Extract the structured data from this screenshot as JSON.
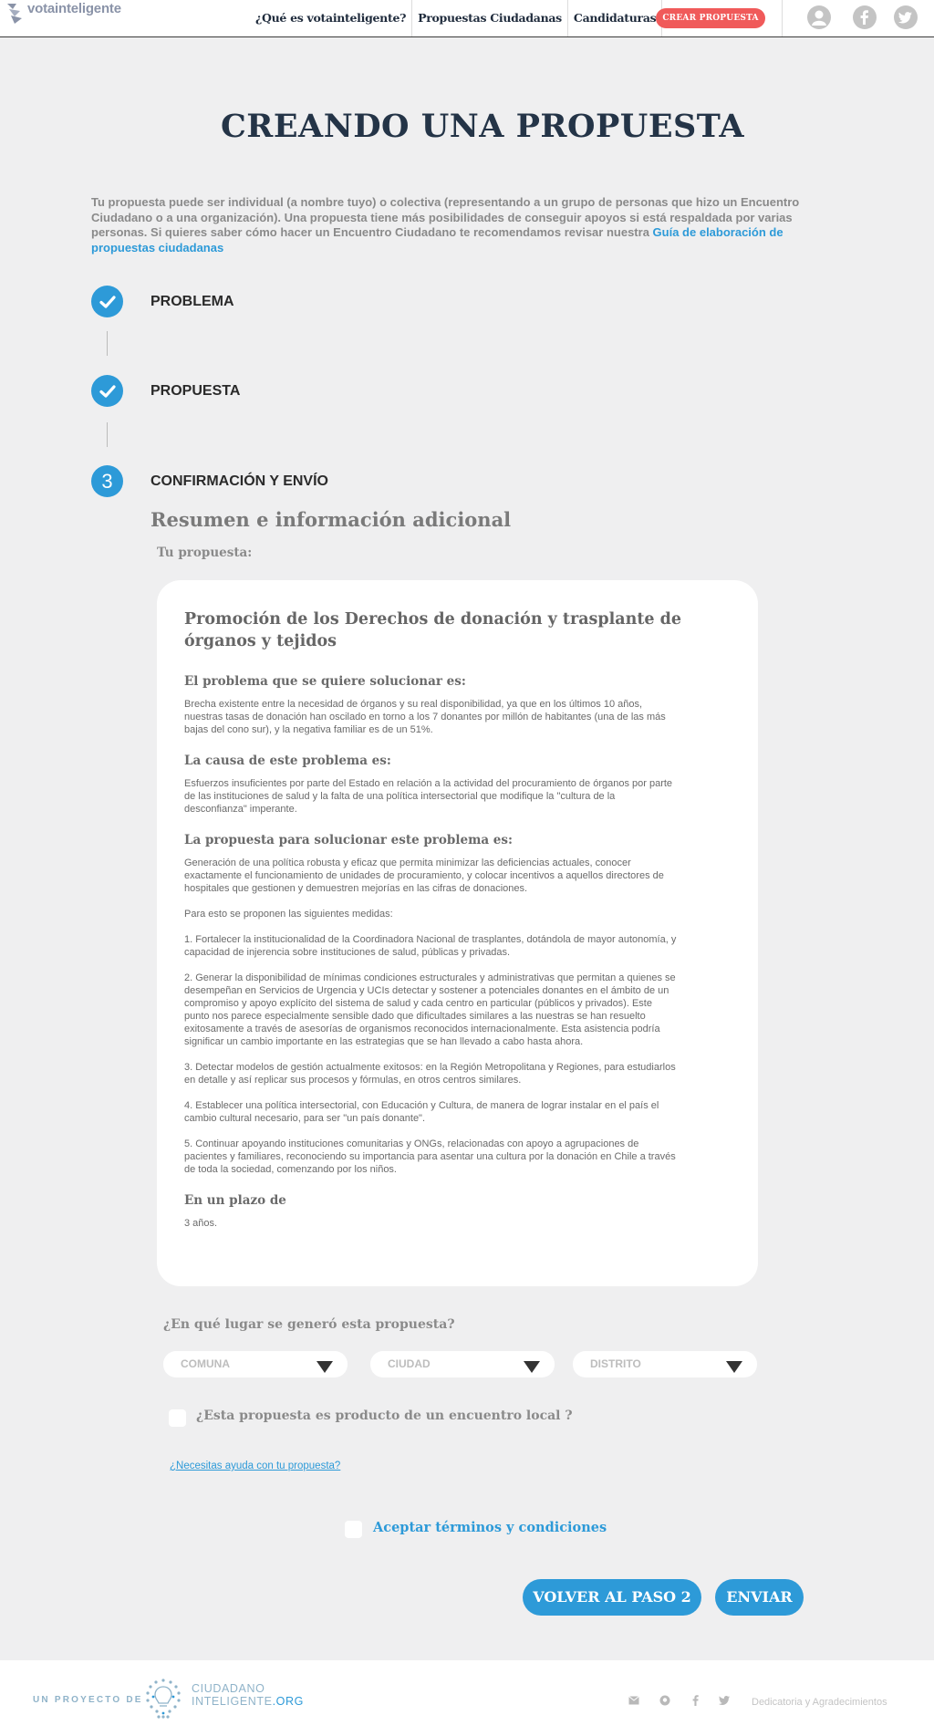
{
  "header": {
    "logo_text": "votainteligente",
    "nav": [
      "¿Qué es votainteligente?",
      "Propuestas Ciudadanas",
      "Candidaturas"
    ],
    "cta": "CREAR PROPUESTA",
    "icons": [
      "user-icon",
      "facebook-icon",
      "twitter-icon"
    ]
  },
  "page": {
    "title": "CREANDO UNA PROPUESTA",
    "intro": "Tu propuesta puede ser individual (a nombre tuyo) o colectiva (representando a un grupo de personas que hizo un Encuentro Ciudadano o a una organización). Una propuesta tiene más posibilidades de conseguir apoyos si está respaldada por varias personas. Si quieres saber cómo hacer un Encuentro Ciudadano te recomendamos revisar nuestra ",
    "intro_link": "Guía de elaboración de propuestas ciudadanas"
  },
  "steps": [
    {
      "label": "PROBLEMA",
      "state": "done"
    },
    {
      "label": "PROPUESTA",
      "state": "done"
    },
    {
      "label": "CONFIRMACIÓN Y ENVÍO",
      "state": "current",
      "number": "3"
    }
  ],
  "summary": {
    "title": "Resumen e información adicional",
    "your_proposal": "Tu propuesta:",
    "proposal_title": "Promoción de los Derechos de donación y trasplante de órganos y tejidos",
    "problem_heading": "El problema que se quiere solucionar es:",
    "problem_text": "Brecha existente entre la necesidad de órganos y su real disponibilidad, ya que en los últimos 10 años,\nnuestras tasas de donación han oscilado en torno a los 7 donantes por millón de habitantes (una de las más\nbajas del cono sur), y la negativa familiar es de un 51%.",
    "cause_heading": "La causa de este problema es:",
    "cause_text": "Esfuerzos insuficientes por parte del Estado en relación a la actividad del procuramiento de órganos por parte\nde las instituciones de salud y la falta de una política intersectorial que modifique la \"cultura de la\ndesconfianza\" imperante.",
    "solution_heading": "La propuesta para solucionar este problema es:",
    "solution_paragraphs": [
      "Generación de una política robusta y eficaz que permita minimizar las deficiencias actuales, conocer\nexactamente el funcionamiento de unidades de procuramiento, y colocar incentivos a aquellos directores de\nhospitales que gestionen y demuestren mejorías en las cifras de donaciones.",
      "Para esto se proponen las siguientes medidas:",
      "1. Fortalecer la institucionalidad de la Coordinadora Nacional de trasplantes, dotándola de mayor autonomía, y\ncapacidad de injerencia sobre instituciones de salud, públicas y privadas.",
      "2. Generar la disponibilidad de mínimas condiciones estructurales y administrativas que permitan a quienes se\ndesempeñan en Servicios de Urgencia y UCIs detectar y sostener a potenciales donantes en el ámbito de un\ncompromiso y apoyo explícito del sistema de salud y cada centro en particular (públicos y privados). Este\npunto nos parece especialmente sensible dado que dificultades similares a las nuestras se han resuelto\nexitosamente a través de asesorías de organismos reconocidos internacionalmente. Esta asistencia podría\nsignificar un cambio importante en las estrategias que se han llevado a cabo hasta ahora.",
      "3. Detectar modelos de gestión actualmente exitosos: en la Región Metropolitana y Regiones, para estudiarlos\nen detalle y así replicar sus procesos y fórmulas, en otros centros similares.",
      "4. Establecer una política intersectorial, con Educación y Cultura, de manera de lograr instalar en el país el\ncambio cultural necesario, para ser \"un país donante\".",
      "5. Continuar apoyando instituciones comunitarias y ONGs, relacionadas con apoyo a agrupaciones de\npacientes y familiares, reconociendo su importancia para asentar una cultura por la donación en Chile a través\nde toda la sociedad, comenzando por los niños."
    ],
    "term_heading": "En un plazo de",
    "term_text": "3 años."
  },
  "form": {
    "place_question": "¿En qué lugar se generó esta propuesta?",
    "comuna_placeholder": "COMUNA",
    "ciudad_placeholder": "CIUDAD",
    "distrito_placeholder": "DISTRITO",
    "local_meeting": "¿Esta propuesta es producto de un encuentro local ?",
    "help_link": "¿Necesitas ayuda con tu propuesta?",
    "terms": "Aceptar términos y condiciones",
    "back_button": "VOLVER AL PASO 2",
    "submit_button": "ENVIAR"
  },
  "footer": {
    "project_of": "UN PROYECTO DE",
    "org_line1": "CIUDADANO",
    "org_line2": "INTELIGENTE",
    "org_suffix": ".ORG",
    "icons": [
      "mail-icon",
      "github-icon",
      "facebook-icon",
      "twitter-icon"
    ],
    "dedication": "Dedicatoria y Agradecimientos"
  },
  "colors": {
    "accent": "#2d9ad8",
    "cta": "#f05a5a",
    "title": "#243447",
    "background": "#efeff0"
  }
}
